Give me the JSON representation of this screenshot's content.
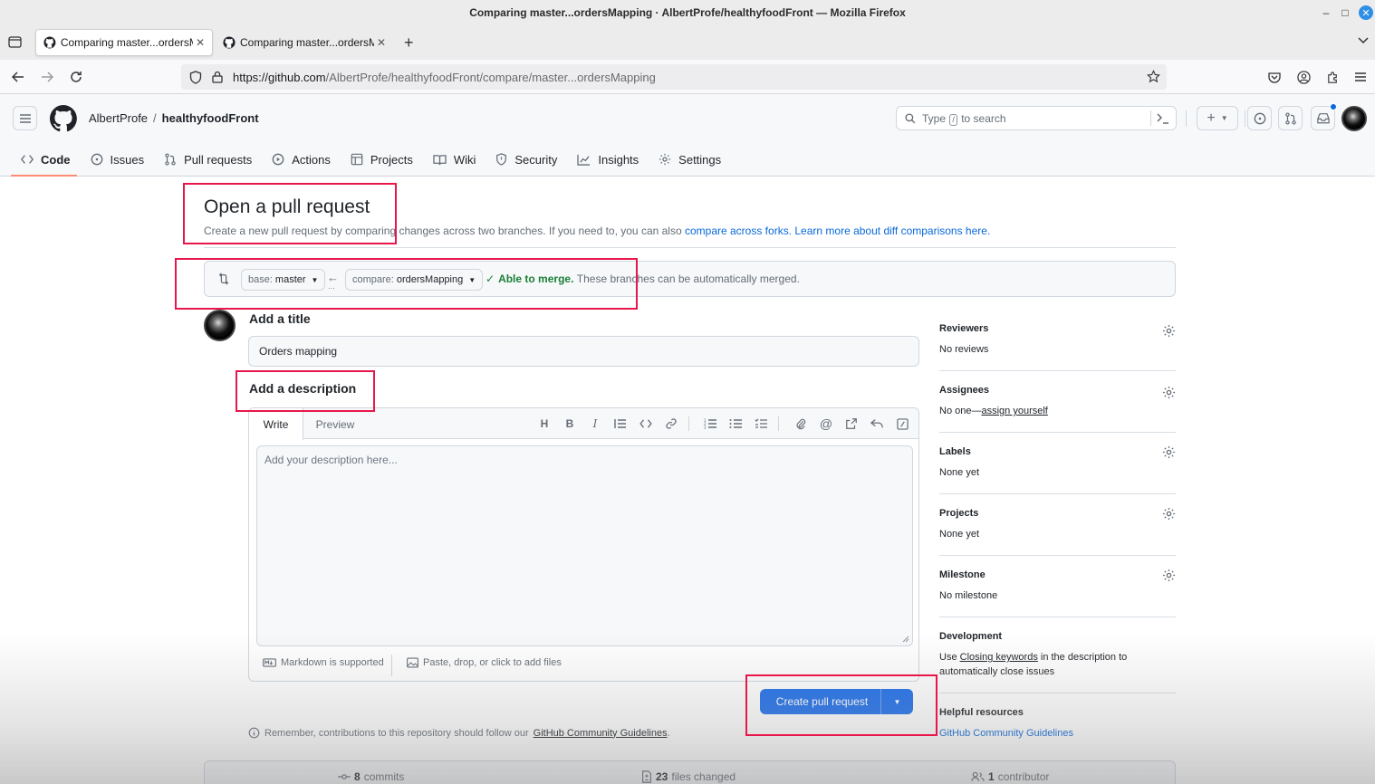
{
  "window": {
    "title": "Comparing master...ordersMapping · AlbertProfe/healthyfoodFront — Mozilla Firefox"
  },
  "tabs": [
    {
      "label": "Comparing master...ordersMapping"
    },
    {
      "label": "Comparing master...ordersMapping"
    }
  ],
  "browser": {
    "url_domain": "https://github.com",
    "url_path": "/AlbertProfe/healthyfoodFront/compare/master...ordersMapping"
  },
  "repo": {
    "owner": "AlbertProfe",
    "separator": "/",
    "name": "healthyfoodFront"
  },
  "search": {
    "prefix": "Type",
    "key": "/",
    "suffix": "to search"
  },
  "nav_tabs": [
    "Code",
    "Issues",
    "Pull requests",
    "Actions",
    "Projects",
    "Wiki",
    "Security",
    "Insights",
    "Settings"
  ],
  "page": {
    "title": "Open a pull request",
    "subtitle": "Create a new pull request by comparing changes across two branches. If you need to, you can also ",
    "link_forks": "compare across forks.",
    "link_learn": "Learn more about diff comparisons here."
  },
  "compare": {
    "base_prefix": "base:",
    "base_branch": "master",
    "compare_prefix": "compare:",
    "compare_branch": "ordersMapping",
    "merge_status": "Able to merge.",
    "merge_text": "These branches can be automatically merged."
  },
  "form": {
    "title_label": "Add a title",
    "title_value": "Orders mapping",
    "desc_label": "Add a description",
    "tab_write": "Write",
    "tab_preview": "Preview",
    "desc_placeholder": "Add your description here...",
    "markdown_note": "Markdown is supported",
    "attach_note": "Paste, drop, or click to add files",
    "submit": "Create pull request"
  },
  "sidebar": {
    "reviewers_h": "Reviewers",
    "reviewers_v": "No reviews",
    "assignees_h": "Assignees",
    "assignees_v": "No one—",
    "assign_link": "assign yourself",
    "labels_h": "Labels",
    "labels_v": "None yet",
    "projects_h": "Projects",
    "projects_v": "None yet",
    "milestone_h": "Milestone",
    "milestone_v": "No milestone",
    "development_h": "Development",
    "development_pre": "Use ",
    "development_link": "Closing keywords",
    "development_post": " in the description to",
    "development_line2": "automatically close issues",
    "helpful_h": "Helpful resources",
    "helpful_link": "GitHub Community Guidelines"
  },
  "footer": {
    "remember": "Remember, contributions to this repository should follow our",
    "remember_link": "GitHub Community Guidelines",
    "remember_end": "."
  },
  "summary": {
    "commits_n": "8",
    "commits_l": "commits",
    "files_n": "23",
    "files_l": "files changed",
    "contrib_n": "1",
    "contrib_l": "contributor"
  },
  "colors": {
    "accent": "#0969da",
    "primary_button": "#1f6feb",
    "success": "#1a7f37",
    "highlight": "#e8174b"
  }
}
